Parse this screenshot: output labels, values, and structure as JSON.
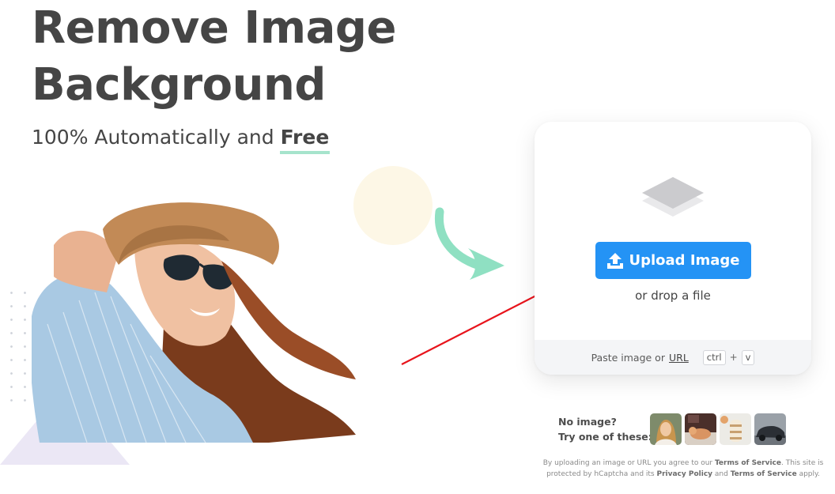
{
  "hero": {
    "title": "Remove Image\nBackground",
    "subtitle_prefix": "100% Automatically and ",
    "subtitle_emphasis": "Free"
  },
  "upload": {
    "button_label": "Upload Image",
    "drop_text": "or drop a file",
    "paste_text": "Paste image or ",
    "paste_link": "URL",
    "key_ctrl": "ctrl",
    "key_plus": "+",
    "key_v": "v"
  },
  "samples": {
    "line1": "No image?",
    "line2": "Try one of these:",
    "thumbnails": [
      "sample-woman",
      "sample-animal",
      "sample-food",
      "sample-car"
    ]
  },
  "legal": {
    "t1": "By uploading an image or URL you agree to our ",
    "terms": "Terms of Service",
    "t2": ". This site is protected by hCaptcha and its ",
    "privacy": "Privacy Policy",
    "t3": " and ",
    "terms2": "Terms of Service",
    "t4": " apply."
  },
  "colors": {
    "button": "#2493f5",
    "accent_underline": "#a6e4cc",
    "teal_arrow": "#8fe0c2",
    "red_arrow": "#e8141c",
    "text": "#454545"
  },
  "icons": {
    "upload": "upload-arrow-icon",
    "layers": "layers-icon"
  }
}
